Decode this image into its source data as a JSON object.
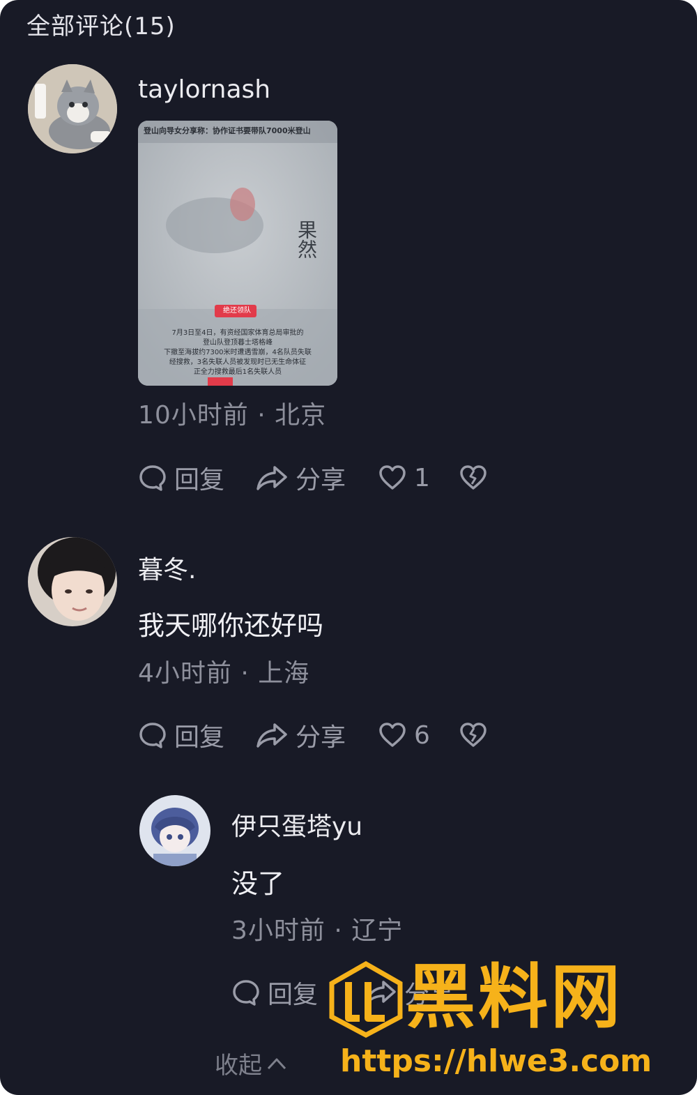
{
  "header": {
    "title": "全部评论(15)"
  },
  "comments": [
    {
      "user": "taylornash",
      "avatar": "cat-avatar",
      "attachment": {
        "headline": "登山向导女分享称：协作证书要带队7000米登山",
        "side_text": "果然",
        "caption_red": "绝还领队",
        "body_lines": [
          "7月3日至4日，有资经国家体育总局审批的",
          "登山队登顶暮士塔格峰",
          "下撤至海拔约7300米时遭遇雪崩，4名队员失联",
          "经搜救，3名失联人员被发现时已无生命体征",
          "正全力搜救最后1名失联人员"
        ]
      },
      "time": "10小时前",
      "location": "北京",
      "reply_label": "回复",
      "share_label": "分享",
      "likes": "1"
    },
    {
      "user": "暮冬.",
      "avatar": "girl-avatar",
      "text": "我天哪你还好吗",
      "time": "4小时前",
      "location": "上海",
      "reply_label": "回复",
      "share_label": "分享",
      "likes": "6"
    },
    {
      "user": "伊只蛋塔yu",
      "avatar": "anime-avatar",
      "text": "没了",
      "time": "3小时前",
      "location": "辽宁",
      "reply_label": "回复",
      "share_label": "分享"
    }
  ],
  "collapse_label": "收起",
  "watermark": {
    "brand": "黑料网",
    "url": "https://hlwe3.com"
  },
  "colors": {
    "background": "#181a26",
    "text": "#e8e8ec",
    "meta": "#8e909c",
    "watermark": "#f6b21a"
  }
}
